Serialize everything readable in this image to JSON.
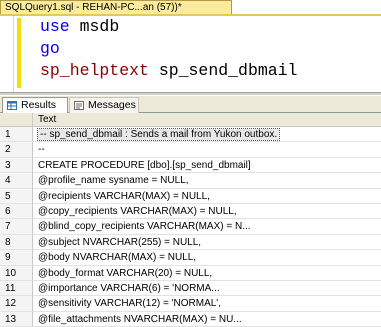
{
  "document_tab": {
    "title": "SQLQuery1.sql - REHAN-PC...an (57))*"
  },
  "editor": {
    "lines": [
      {
        "keyword": "use",
        "rest": "msdb"
      },
      {
        "keyword": "go",
        "rest": ""
      },
      {
        "keyword": "sp_helptext",
        "rest": "sp_send_dbmail"
      }
    ]
  },
  "results_tabs": [
    {
      "label": "Results",
      "icon": "grid-icon",
      "active": true
    },
    {
      "label": "Messages",
      "icon": "messages-icon",
      "active": false
    }
  ],
  "grid": {
    "column_header": "Text",
    "rows": [
      {
        "num": "1",
        "text": "-- sp_send_dbmail : Sends a mail from Yukon outbox."
      },
      {
        "num": "2",
        "text": "--"
      },
      {
        "num": "3",
        "text": "CREATE PROCEDURE [dbo].[sp_send_dbmail]"
      },
      {
        "num": "4",
        "text": "    @profile_name           sysname      = NULL,"
      },
      {
        "num": "5",
        "text": "    @recipients               VARCHAR(MAX)  = NULL,"
      },
      {
        "num": "6",
        "text": "    @copy_recipients           VARCHAR(MAX)  = NULL,"
      },
      {
        "num": "7",
        "text": "    @blind_copy_recipients       VARCHAR(MAX)  = N..."
      },
      {
        "num": "8",
        "text": "    @subject                  NVARCHAR(255) = NULL,"
      },
      {
        "num": "9",
        "text": "    @body                     NVARCHAR(MAX) = NULL,"
      },
      {
        "num": "10",
        "text": "    @body_format              VARCHAR(20)   = NULL,"
      },
      {
        "num": "11",
        "text": "    @importance               VARCHAR(6)    = 'NORMA..."
      },
      {
        "num": "12",
        "text": "    @sensitivity              VARCHAR(12)   = 'NORMAL',"
      },
      {
        "num": "13",
        "text": "    @file_attachments         NVARCHAR(MAX) = NU..."
      }
    ]
  },
  "colors": {
    "keyword": "#0000ff",
    "procedure": "#8b0000",
    "tab_active": "#fbeb9d",
    "change_bar": "#f2e100"
  }
}
